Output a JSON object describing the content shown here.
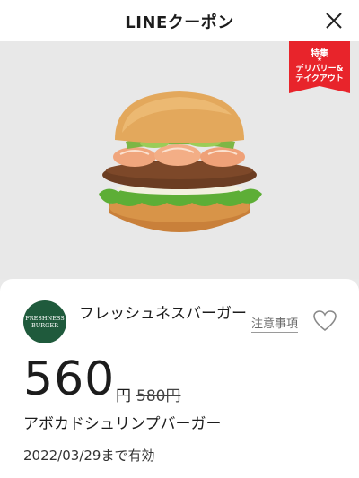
{
  "header": {
    "title": "LINEクーポン"
  },
  "badge": {
    "top": "特集",
    "star": "★",
    "line1": "デリバリー&",
    "line2": "テイクアウト",
    "color": "#e8242b"
  },
  "store": {
    "logo_line1": "FRESHNESS",
    "logo_line2": "BURGER",
    "name": "フレッシュネスバーガー",
    "notes_link": "注意事項"
  },
  "coupon": {
    "price": "560",
    "yen": "円",
    "original_price": "580円",
    "product_name": "アボカドシュリンプバーガー",
    "valid_until": "2022/03/29まで有効"
  },
  "icons": {
    "close": "close-icon",
    "favorite": "heart-icon"
  }
}
